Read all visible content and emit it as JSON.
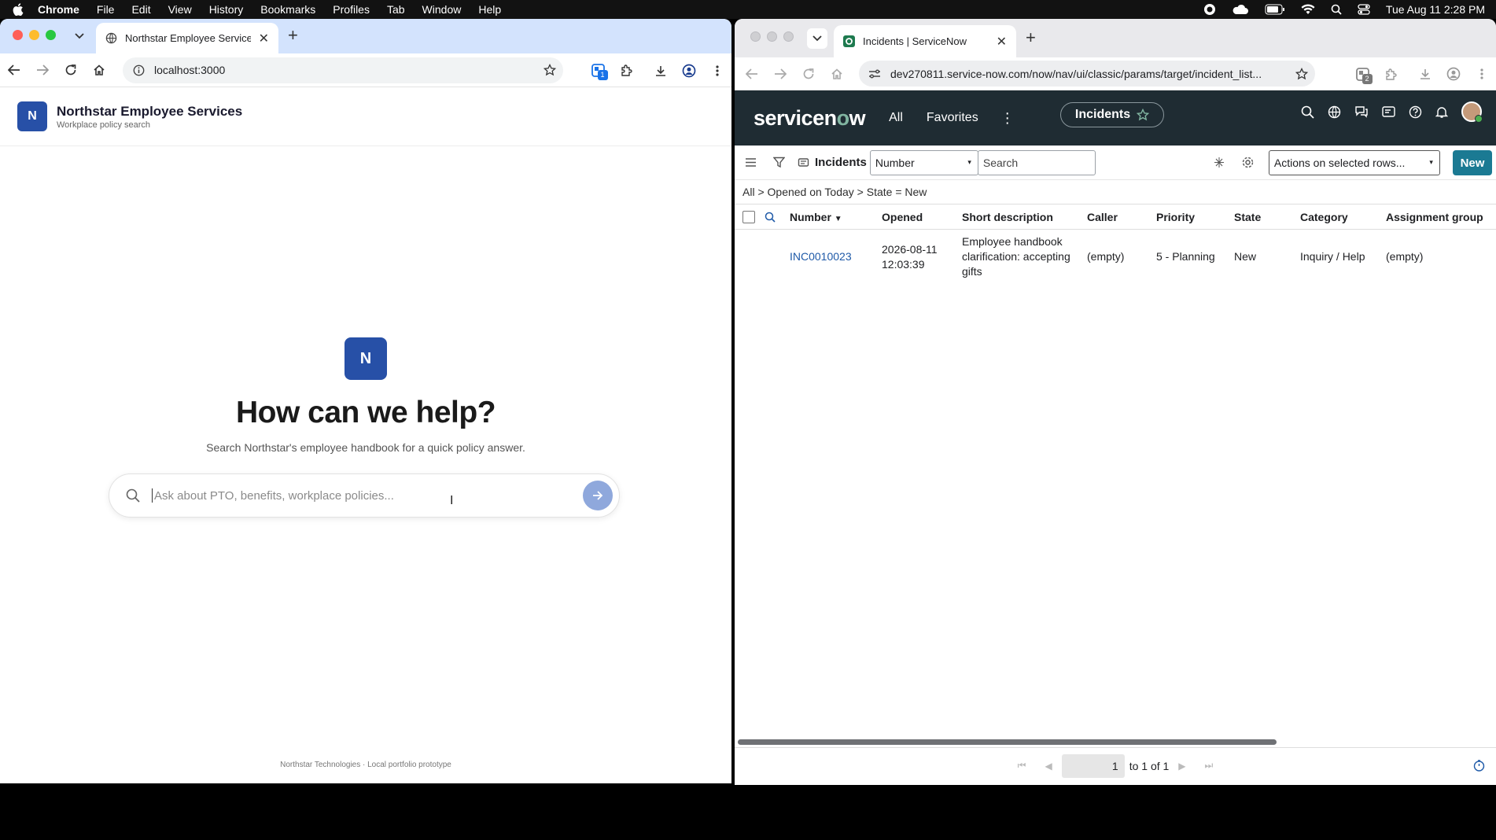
{
  "menubar": {
    "app": "Chrome",
    "items": [
      "File",
      "Edit",
      "View",
      "History",
      "Bookmarks",
      "Profiles",
      "Tab",
      "Window",
      "Help"
    ],
    "clock": "Tue Aug 11  2:28 PM"
  },
  "left_window": {
    "tab_title": "Northstar Employee Services",
    "url": "localhost:3000",
    "extension_badge": "1",
    "app_logo": "N",
    "app_title": "Northstar Employee Services",
    "app_subtitle": "Workplace policy search",
    "hero_logo": "N",
    "hero_title": "How can we help?",
    "hero_subtitle": "Search Northstar's employee handbook for a quick policy answer.",
    "search_placeholder": "Ask about PTO, benefits, workplace policies...",
    "footer": "Northstar Technologies · Local portfolio prototype"
  },
  "right_window": {
    "tab_title": "Incidents | ServiceNow",
    "url": "dev270811.service-now.com/now/nav/ui/classic/params/target/incident_list...",
    "extension_badge": "2",
    "brand_left": "servicen",
    "brand_o": "o",
    "brand_right": "w",
    "nav_all": "All",
    "nav_favorites": "Favorites",
    "context_pill": "Incidents",
    "list_title": "Incidents",
    "field_select": "Number",
    "search_placeholder": "Search",
    "actions_select": "Actions on selected rows...",
    "new_button": "New",
    "breadcrumb": "All > Opened on Today > State = New",
    "columns": [
      "Number",
      "Opened",
      "Short description",
      "Caller",
      "Priority",
      "State",
      "Category",
      "Assignment group"
    ],
    "rows": [
      {
        "number": "INC0010023",
        "opened": "2026-08-11 12:03:39",
        "short_description": "Employee handbook clarification: accepting gifts",
        "caller": "(empty)",
        "priority": "5 - Planning",
        "state": "New",
        "category": "Inquiry / Help",
        "assignment_group": "(empty)"
      }
    ],
    "pager_value": "1",
    "pager_text": "to 1 of 1"
  },
  "colors": {
    "northstar_blue": "#2750a7",
    "servicenow_header": "#1f2c33",
    "servicenow_green": "#81b5a1",
    "new_button": "#1b7a93",
    "link": "#1f5aa8"
  }
}
